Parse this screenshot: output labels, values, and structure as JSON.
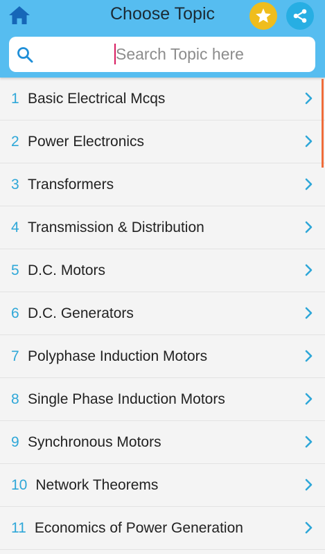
{
  "header": {
    "title": "Choose Topic",
    "home_icon": "home-icon",
    "star_icon": "star-icon",
    "share_icon": "share-icon",
    "colors": {
      "bar": "#56bdf0",
      "star": "#efbd1d",
      "share": "#27aee3"
    }
  },
  "search": {
    "placeholder": "Search Topic here",
    "value": ""
  },
  "topics": [
    {
      "num": "1",
      "label": "Basic Electrical Mcqs"
    },
    {
      "num": "2",
      "label": "Power Electronics"
    },
    {
      "num": "3",
      "label": "Transformers"
    },
    {
      "num": "4",
      "label": "Transmission & Distribution"
    },
    {
      "num": "5",
      "label": "D.C. Motors"
    },
    {
      "num": "6",
      "label": "D.C. Generators"
    },
    {
      "num": "7",
      "label": "Polyphase Induction Motors"
    },
    {
      "num": "8",
      "label": "Single Phase Induction Motors"
    },
    {
      "num": "9",
      "label": "Synchronous Motors"
    },
    {
      "num": "10",
      "label": "Network Theorems"
    },
    {
      "num": "11",
      "label": "Economics of Power Generation"
    }
  ],
  "accent_color": "#2ea7d8"
}
